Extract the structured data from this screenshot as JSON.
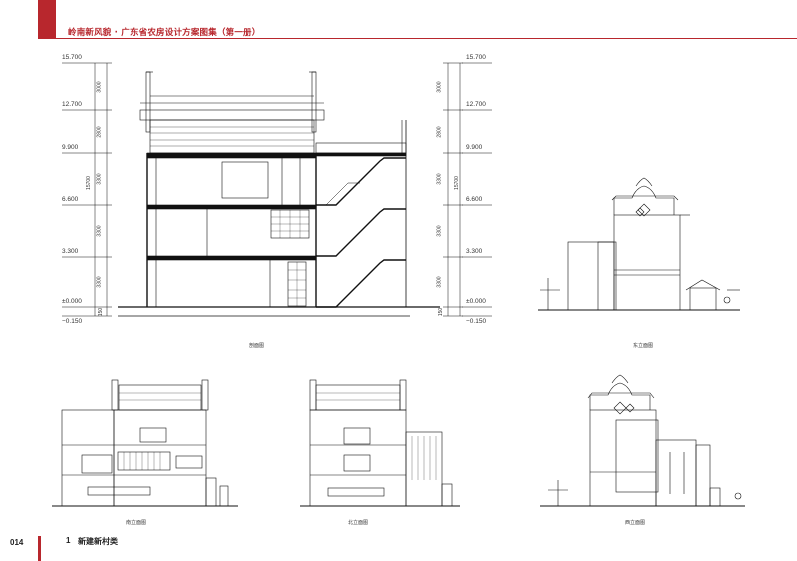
{
  "header": {
    "title": "岭南新风貌 · 广东省农房设计方案图集（第一册）",
    "accent_color": "#b8272d"
  },
  "footer": {
    "page_number": "014",
    "chapter_number": "1",
    "chapter_title": "新建新村类"
  },
  "section": {
    "levels_left": [
      "15.700",
      "12.700",
      "9.900",
      "6.600",
      "3.300",
      "±0.000",
      "−0.150"
    ],
    "levels_right": [
      "15.700",
      "12.700",
      "9.900",
      "6.600",
      "3.300",
      "±0.000",
      "−0.150"
    ],
    "dims_left": [
      "3000",
      "2800",
      "3300",
      "3300",
      "3300",
      "150"
    ],
    "dim_total_left": "15700",
    "dims_right": [
      "3000",
      "2800",
      "3300",
      "3300",
      "3300",
      "150"
    ],
    "dim_total_right": "15700"
  },
  "captions": {
    "section": "剖面图",
    "east": "东立面图",
    "south": "南立面图",
    "north": "北立面图",
    "west": "西立面图"
  }
}
